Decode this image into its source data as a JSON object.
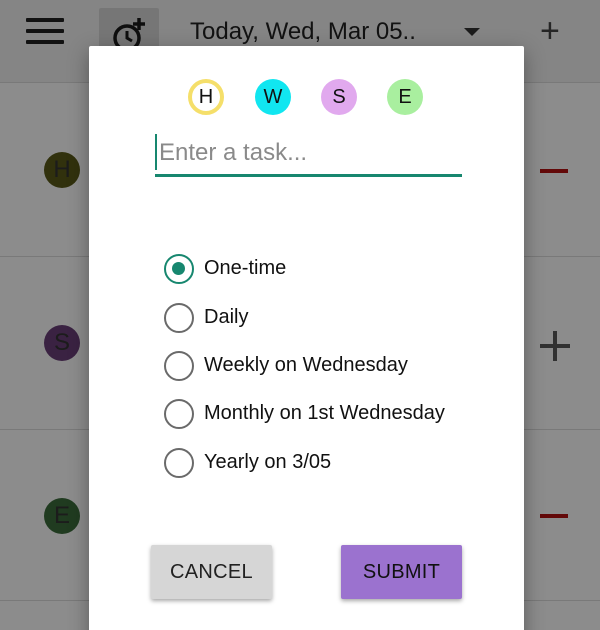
{
  "toolbar": {
    "date_label": "Today, Wed, Mar 05..",
    "add_symbol": "+"
  },
  "rows": [
    {
      "initial": "H",
      "color": "#5a5a18",
      "action": "minus",
      "action_color": "#b41212"
    },
    {
      "initial": "S",
      "color": "#6a3f78",
      "action": "plus",
      "action_color": "#5a5a5a"
    },
    {
      "initial": "E",
      "color": "#3b6c3b",
      "action": "minus",
      "action_color": "#b41212"
    }
  ],
  "dialog": {
    "categories": [
      {
        "letter": "H",
        "color": "#ffffff",
        "ring": "#f5df6a",
        "selected": true
      },
      {
        "letter": "W",
        "color": "#11e6f0",
        "selected": false
      },
      {
        "letter": "S",
        "color": "#e1a9ee",
        "selected": false
      },
      {
        "letter": "E",
        "color": "#a9ef9f",
        "selected": false
      }
    ],
    "task_placeholder": "Enter a task...",
    "task_value": "",
    "recurrence_options": [
      {
        "label": "One-time",
        "checked": true
      },
      {
        "label": "Daily",
        "checked": false
      },
      {
        "label": "Weekly on Wednesday",
        "checked": false
      },
      {
        "label": "Monthly on 1st Wednesday",
        "checked": false
      },
      {
        "label": "Yearly on 3/05",
        "checked": false
      }
    ],
    "cancel_label": "CANCEL",
    "submit_label": "SUBMIT"
  },
  "colors": {
    "accent": "#17876f",
    "submit": "#9b72cf",
    "cancel": "#d6d6d6"
  }
}
